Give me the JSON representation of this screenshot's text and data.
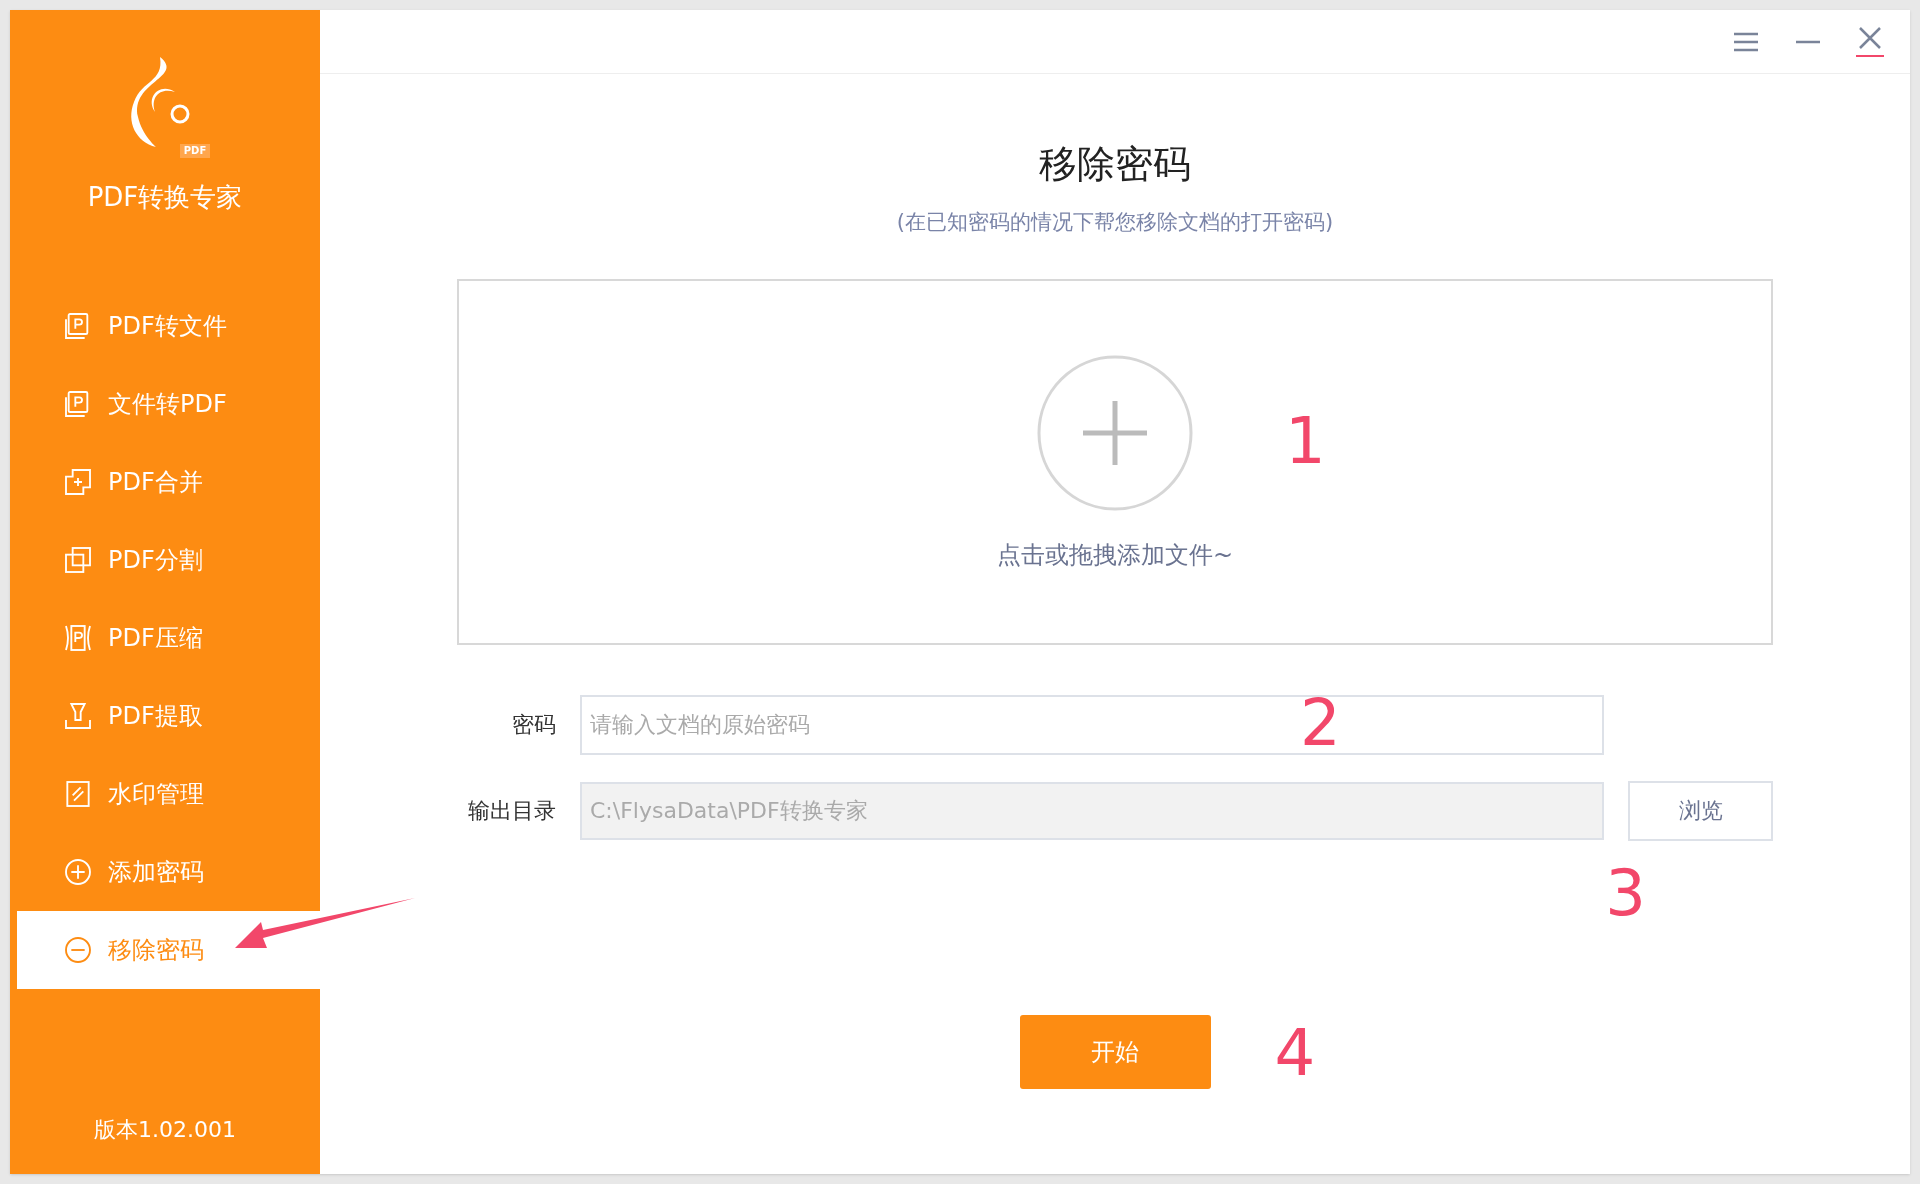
{
  "app": {
    "name": "PDF转换专家",
    "logo_badge": "PDF",
    "version": "版本1.02.001"
  },
  "sidebar": {
    "items": [
      {
        "label": "PDF转文件",
        "kind": "doc-p",
        "selected": false
      },
      {
        "label": "文件转PDF",
        "kind": "doc-p",
        "selected": false
      },
      {
        "label": "PDF合并",
        "kind": "merge",
        "selected": false
      },
      {
        "label": "PDF分割",
        "kind": "split",
        "selected": false
      },
      {
        "label": "PDF压缩",
        "kind": "compress",
        "selected": false
      },
      {
        "label": "PDF提取",
        "kind": "extract",
        "selected": false
      },
      {
        "label": "水印管理",
        "kind": "watermark",
        "selected": false
      },
      {
        "label": "添加密码",
        "kind": "plus-circle",
        "selected": false
      },
      {
        "label": "移除密码",
        "kind": "minus-circle",
        "selected": true
      }
    ]
  },
  "page": {
    "title": "移除密码",
    "subtitle": "(在已知密码的情况下帮您移除文档的打开密码)",
    "drop_zone": {
      "hint": "点击或拖拽添加文件~"
    },
    "password": {
      "label": "密码",
      "placeholder": "请输入文档的原始密码"
    },
    "output_dir": {
      "label": "输出目录",
      "value": "C:\\FlysaData\\PDF转换专家",
      "browse": "浏览"
    },
    "start": "开始"
  },
  "annotations": [
    "1",
    "2",
    "3",
    "4"
  ]
}
